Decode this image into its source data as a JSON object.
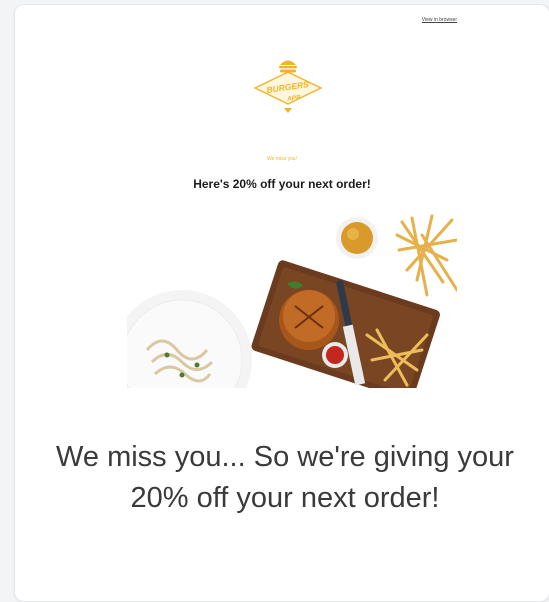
{
  "email": {
    "top_link": "View in browser",
    "logo": {
      "text_line1": "BURGERS",
      "text_line2": "APP",
      "icon": "burger-icon",
      "color": "#f0b428"
    },
    "tagline": "We miss you!",
    "headline": "Here's 20% off your next order!",
    "hero_image": {
      "description_icon": "food-photo"
    },
    "body_message": "We miss you... So we're giving your 20% off your next order!"
  },
  "colors": {
    "accent": "#f0b428",
    "text_dark": "#1b1b1b",
    "text_body": "#3a3a3a",
    "background": "#f3f4f6",
    "card": "#ffffff"
  }
}
